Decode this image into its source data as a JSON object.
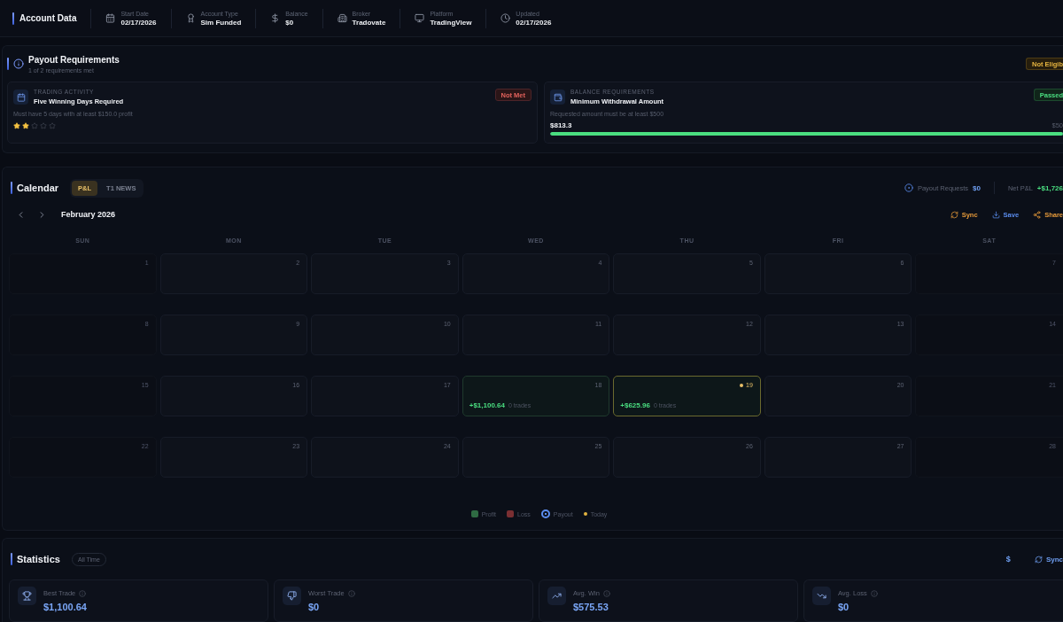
{
  "account_bar": {
    "title": "Account Data",
    "fields": [
      {
        "label": "Start Date",
        "value": "02/17/2026"
      },
      {
        "label": "Account Type",
        "value": "Sim Funded"
      },
      {
        "label": "Balance",
        "value": "$0"
      },
      {
        "label": "Broker",
        "value": "Tradovate"
      },
      {
        "label": "Platform",
        "value": "TradingView"
      },
      {
        "label": "Updated",
        "value": "02/17/2026"
      }
    ]
  },
  "payout": {
    "title": "Payout Requirements",
    "subtitle": "1 of 2 requirements met",
    "status": {
      "text": "Not Eligib",
      "kind": "warning"
    },
    "requirements": [
      {
        "kind": "stars",
        "category": "TRADING ACTIVITY",
        "title": "Five Winning Days Required",
        "description": "Must have 5 days with at least $150.0 profit",
        "status": {
          "text": "Not Met",
          "kind": "fail"
        },
        "stars": 2
      },
      {
        "kind": "progress",
        "category": "BALANCE REQUIREMENTS",
        "title": "Minimum Withdrawal Amount",
        "description": "Requested amount must be at least $500",
        "status": {
          "text": "Passed",
          "kind": "pass"
        },
        "current": "$813.3",
        "target": "$50",
        "level": 1
      }
    ]
  },
  "calendar": {
    "title": "Calendar",
    "tabs": [
      {
        "label": "P&L",
        "selected": true
      },
      {
        "label": "T1 NEWS",
        "selected": false
      }
    ],
    "payout_requests": {
      "label": "Payout Requests",
      "value": "$0"
    },
    "net_pnl": {
      "label": "Net P&L",
      "value": "+$1,726"
    },
    "month": "February 2026",
    "actions": [
      {
        "label": "Sync",
        "kind": "sync"
      },
      {
        "label": "Save",
        "kind": "save"
      },
      {
        "label": "Share",
        "kind": "share"
      }
    ],
    "weekdays": [
      "SUN",
      "MON",
      "TUE",
      "WED",
      "THU",
      "FRI",
      "SAT"
    ],
    "weeks": [
      [
        {
          "day": "1",
          "kind": "empty",
          "today": false
        },
        {
          "day": "2",
          "kind": "empty",
          "today": false
        },
        {
          "day": "3",
          "kind": "empty",
          "today": false
        },
        {
          "day": "4",
          "kind": "empty",
          "today": false
        },
        {
          "day": "5",
          "kind": "empty",
          "today": false
        },
        {
          "day": "6",
          "kind": "empty",
          "today": false
        },
        {
          "day": "7",
          "kind": "empty",
          "today": false
        }
      ],
      [
        {
          "day": "8",
          "kind": "empty",
          "today": false
        },
        {
          "day": "9",
          "kind": "empty",
          "today": false
        },
        {
          "day": "10",
          "kind": "empty",
          "today": false
        },
        {
          "day": "11",
          "kind": "empty",
          "today": false
        },
        {
          "day": "12",
          "kind": "empty",
          "today": false
        },
        {
          "day": "13",
          "kind": "empty",
          "today": false
        },
        {
          "day": "14",
          "kind": "empty",
          "today": false
        }
      ],
      [
        {
          "day": "15",
          "kind": "empty",
          "today": false
        },
        {
          "day": "16",
          "kind": "empty",
          "today": false
        },
        {
          "day": "17",
          "kind": "empty",
          "today": false
        },
        {
          "day": "18",
          "kind": "profit",
          "today": false,
          "pnl": "+$1,100.64",
          "trades": "0 trades"
        },
        {
          "day": "19",
          "kind": "profit",
          "today": true,
          "pnl": "+$625.96",
          "trades": "0 trades"
        },
        {
          "day": "20",
          "kind": "empty",
          "today": false
        },
        {
          "day": "21",
          "kind": "empty",
          "today": false
        }
      ],
      [
        {
          "day": "22",
          "kind": "empty",
          "today": false
        },
        {
          "day": "23",
          "kind": "empty",
          "today": false
        },
        {
          "day": "24",
          "kind": "empty",
          "today": false
        },
        {
          "day": "25",
          "kind": "empty",
          "today": false
        },
        {
          "day": "26",
          "kind": "empty",
          "today": false
        },
        {
          "day": "27",
          "kind": "empty",
          "today": false
        },
        {
          "day": "28",
          "kind": "empty",
          "today": false
        }
      ]
    ],
    "legend": [
      {
        "label": "Profit",
        "kind": "square",
        "color": "#2f6b43"
      },
      {
        "label": "Loss",
        "kind": "square",
        "color": "#7a2f32"
      },
      {
        "label": "Payout",
        "kind": "payout",
        "color": "#5b8def"
      },
      {
        "label": "Today",
        "kind": "dot",
        "color": "#e2b340"
      }
    ]
  },
  "statistics": {
    "title": "Statistics",
    "range": "All Time",
    "currency": "$",
    "sync": "Sync",
    "cards": [
      {
        "label": "Best Trade",
        "value": "$1,100.64"
      },
      {
        "label": "Worst Trade",
        "value": "$0"
      },
      {
        "label": "Avg. Win",
        "value": "$575.53"
      },
      {
        "label": "Avg. Loss",
        "value": "$0"
      }
    ]
  }
}
